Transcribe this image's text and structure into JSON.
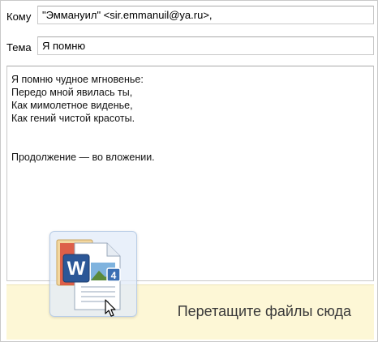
{
  "compose": {
    "to_label": "Кому",
    "to_value": "\"Эммануил\" <sir.emmanuil@ya.ru>,",
    "subject_label": "Тема",
    "subject_value": "Я помню",
    "body_lines": [
      "Я помню чудное мгновенье:",
      "Передо мной явилась ты,",
      "Как мимолетное виденье,",
      "Как гений чистой красоты.",
      "",
      "",
      "Продолжение — во вложении."
    ]
  },
  "drop_zone": {
    "text": "Перетащите файлы сюда"
  },
  "dragged_file": {
    "icon": "word-document-icon",
    "badge": "4"
  },
  "colors": {
    "drop_zone_bg": "#fdf7d6",
    "word_blue": "#2b5797"
  }
}
